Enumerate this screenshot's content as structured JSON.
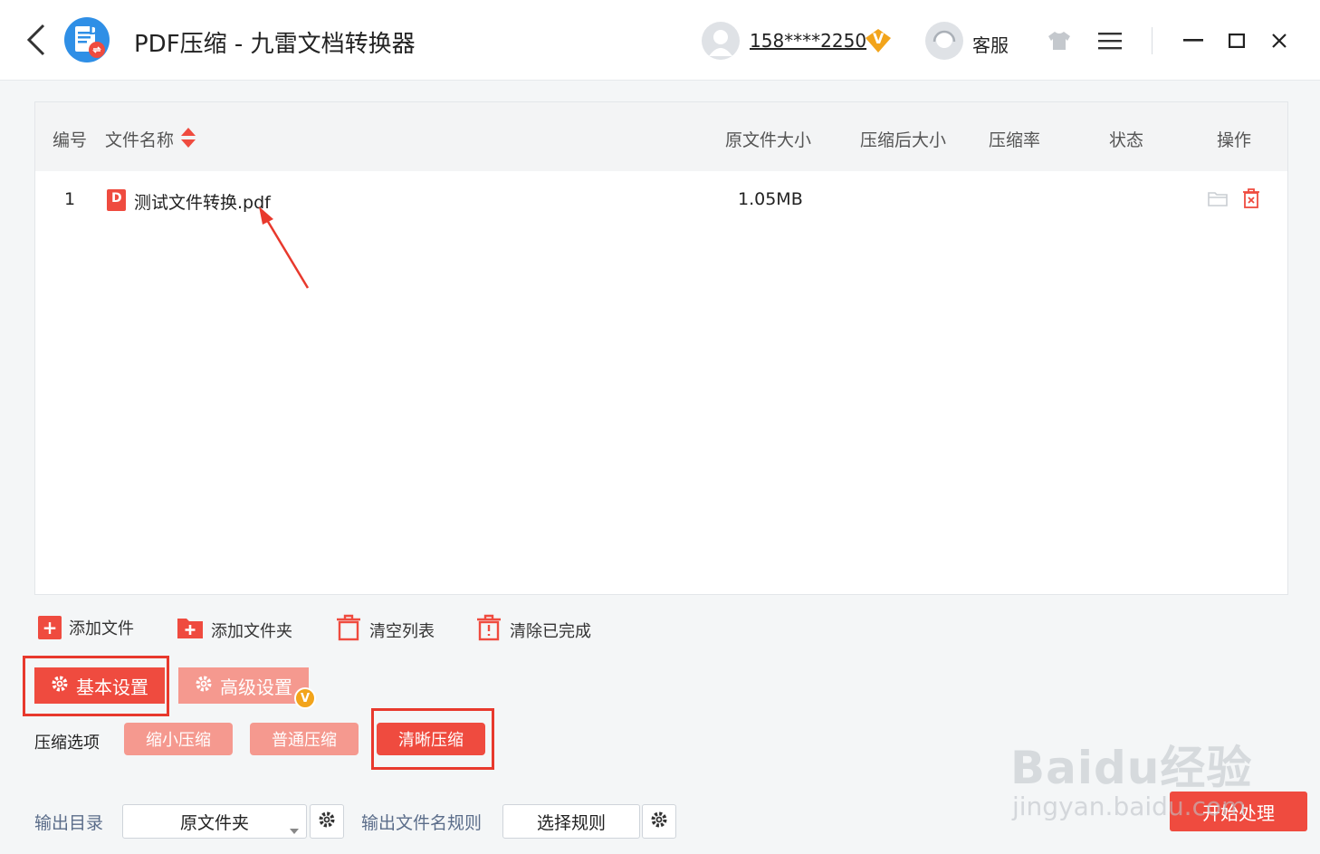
{
  "window": {
    "title": "PDF压缩 - 九雷文档转换器",
    "user_account": "158****2250",
    "vip_badge": "V",
    "service_label": "客服"
  },
  "table": {
    "headers": {
      "index": "编号",
      "filename": "文件名称",
      "original_size": "原文件大小",
      "compressed_size": "压缩后大小",
      "ratio": "压缩率",
      "status": "状态",
      "actions": "操作"
    },
    "rows": [
      {
        "index": "1",
        "file_icon_letter": "D",
        "filename": "测试文件转换.pdf",
        "original_size": "1.05MB",
        "compressed_size": "",
        "ratio": "",
        "status": ""
      }
    ]
  },
  "toolbar": {
    "add_file": "添加文件",
    "add_folder": "添加文件夹",
    "clear_list": "清空列表",
    "clear_done": "清除已完成"
  },
  "settings": {
    "basic_tab": "基本设置",
    "advanced_tab": "高级设置",
    "advanced_badge": "V",
    "compress_label": "压缩选项",
    "options": [
      "缩小压缩",
      "普通压缩",
      "清晰压缩"
    ],
    "selected_option": "清晰压缩"
  },
  "output": {
    "dir_label": "输出目录",
    "dir_value": "原文件夹",
    "name_rule_label": "输出文件名规则",
    "name_rule_value": "选择规则",
    "start_button": "开始处理"
  },
  "watermark": {
    "brand": "Baidu经验",
    "url": "jingyan.baidu.com"
  },
  "colors": {
    "accent": "#ef4b3f",
    "accent_light": "#f5998f",
    "vip_gold": "#f2a41b",
    "annotation_red": "#e8392d"
  }
}
